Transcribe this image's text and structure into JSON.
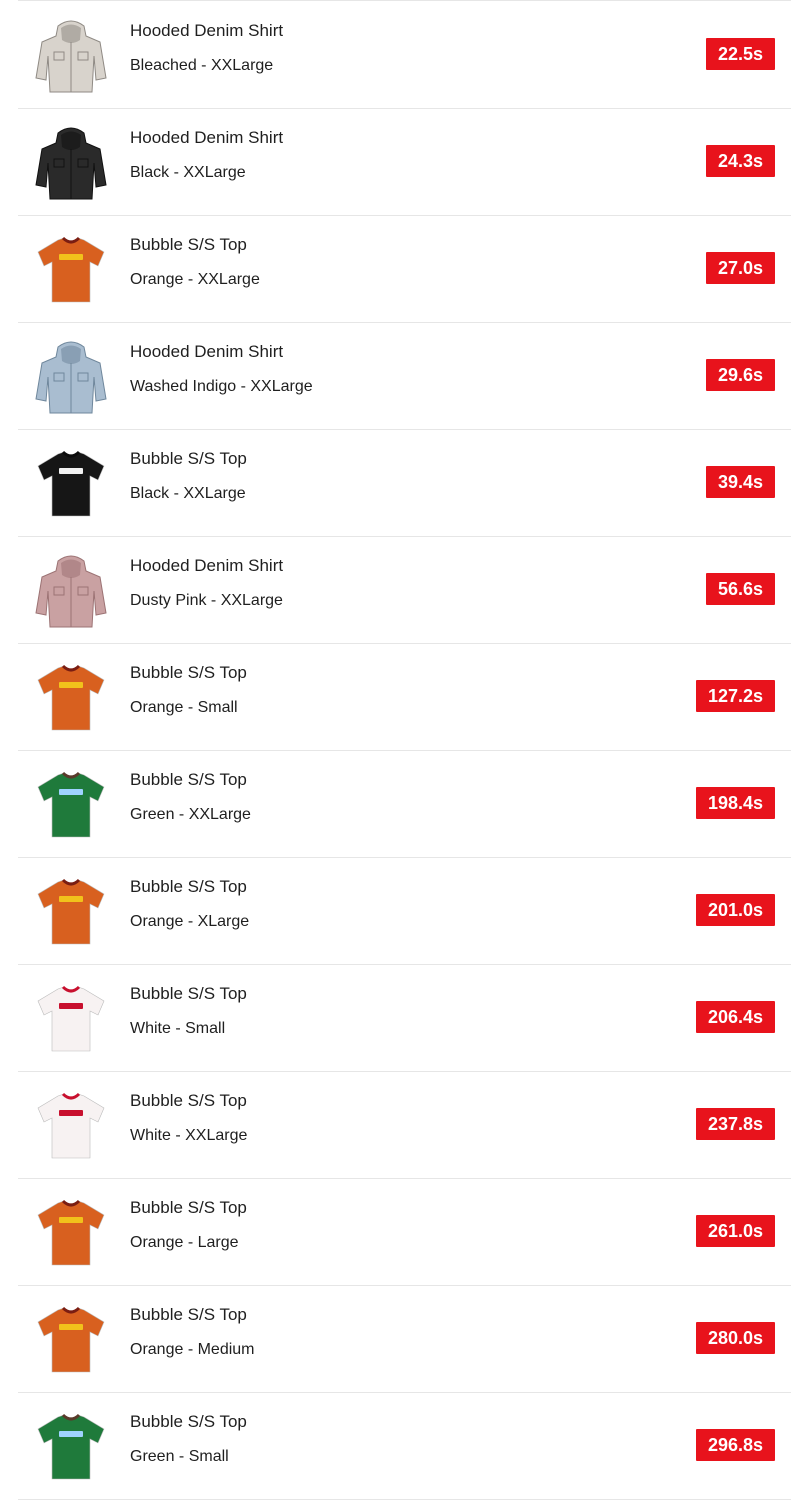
{
  "items": [
    {
      "name": "Hooded Denim Shirt",
      "variant": "Bleached - XXLarge",
      "time": "22.5s",
      "kind": "hoodie",
      "color": "#d8d3cc",
      "accent": "#8f8a84"
    },
    {
      "name": "Hooded Denim Shirt",
      "variant": "Black - XXLarge",
      "time": "24.3s",
      "kind": "hoodie",
      "color": "#2a2a2a",
      "accent": "#111111"
    },
    {
      "name": "Bubble S/S Top",
      "variant": "Orange - XXLarge",
      "time": "27.0s",
      "kind": "tee",
      "color": "#d8601f",
      "accent": "#f1c21b",
      "collar": "#7a1d12"
    },
    {
      "name": "Hooded Denim Shirt",
      "variant": "Washed Indigo - XXLarge",
      "time": "29.6s",
      "kind": "hoodie",
      "color": "#a9bdd0",
      "accent": "#6f879c"
    },
    {
      "name": "Bubble S/S Top",
      "variant": "Black - XXLarge",
      "time": "39.4s",
      "kind": "tee",
      "color": "#161616",
      "accent": "#f2f2f2",
      "collar": "#0c0c0c"
    },
    {
      "name": "Hooded Denim Shirt",
      "variant": "Dusty Pink - XXLarge",
      "time": "56.6s",
      "kind": "hoodie",
      "color": "#c9a1a2",
      "accent": "#9c7374"
    },
    {
      "name": "Bubble S/S Top",
      "variant": "Orange - Small",
      "time": "127.2s",
      "kind": "tee",
      "color": "#d8601f",
      "accent": "#f1c21b",
      "collar": "#7a1d12"
    },
    {
      "name": "Bubble S/S Top",
      "variant": "Green - XXLarge",
      "time": "198.4s",
      "kind": "tee",
      "color": "#1f7a3b",
      "accent": "#9fd3ff",
      "collar": "#5a3a2a"
    },
    {
      "name": "Bubble S/S Top",
      "variant": "Orange - XLarge",
      "time": "201.0s",
      "kind": "tee",
      "color": "#d8601f",
      "accent": "#f1c21b",
      "collar": "#7a1d12"
    },
    {
      "name": "Bubble S/S Top",
      "variant": "White - Small",
      "time": "206.4s",
      "kind": "tee",
      "color": "#f7f2f2",
      "accent": "#c8102e",
      "collar": "#c8102e"
    },
    {
      "name": "Bubble S/S Top",
      "variant": "White - XXLarge",
      "time": "237.8s",
      "kind": "tee",
      "color": "#f7f2f2",
      "accent": "#c8102e",
      "collar": "#c8102e"
    },
    {
      "name": "Bubble S/S Top",
      "variant": "Orange - Large",
      "time": "261.0s",
      "kind": "tee",
      "color": "#d8601f",
      "accent": "#f1c21b",
      "collar": "#7a1d12"
    },
    {
      "name": "Bubble S/S Top",
      "variant": "Orange - Medium",
      "time": "280.0s",
      "kind": "tee",
      "color": "#d8601f",
      "accent": "#f1c21b",
      "collar": "#7a1d12"
    },
    {
      "name": "Bubble S/S Top",
      "variant": "Green - Small",
      "time": "296.8s",
      "kind": "tee",
      "color": "#1f7a3b",
      "accent": "#9fd3ff",
      "collar": "#5a3a2a"
    }
  ]
}
